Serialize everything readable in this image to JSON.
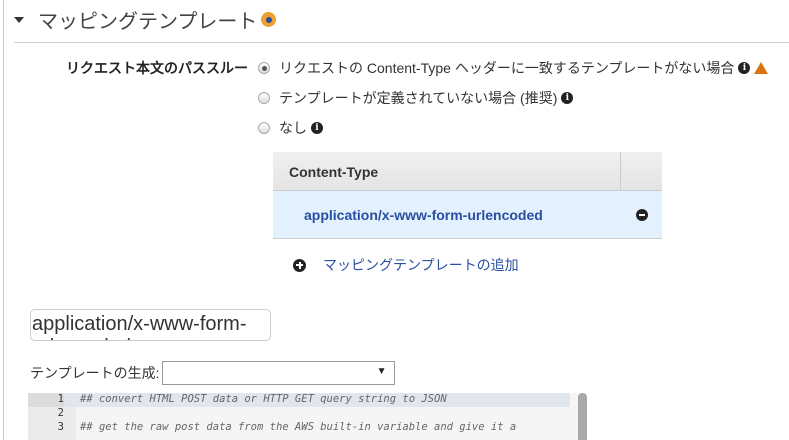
{
  "section": {
    "title": "マッピングテンプレート"
  },
  "passthrough": {
    "label": "リクエスト本文のパススルー",
    "options": [
      {
        "label": "リクエストの Content-Type ヘッダーに一致するテンプレートがない場合",
        "selected": true
      },
      {
        "label": "テンプレートが定義されていない場合 (推奨)",
        "selected": false
      },
      {
        "label": "なし",
        "selected": false
      }
    ]
  },
  "table": {
    "header": "Content-Type",
    "rows": [
      "application/x-www-form-urlencoded"
    ]
  },
  "add_link": "マッピングテンプレートの追加",
  "content_type_input": "application/x-www-form-urlencoded",
  "generate": {
    "label": "テンプレートの生成:",
    "value": ""
  },
  "editor": {
    "lines": [
      {
        "n": "1",
        "text": "## convert HTML POST data or HTTP GET query string to JSON"
      },
      {
        "n": "2",
        "text": ""
      },
      {
        "n": "3",
        "text": "## get the raw post data from the AWS built-in variable and give it a"
      }
    ]
  }
}
